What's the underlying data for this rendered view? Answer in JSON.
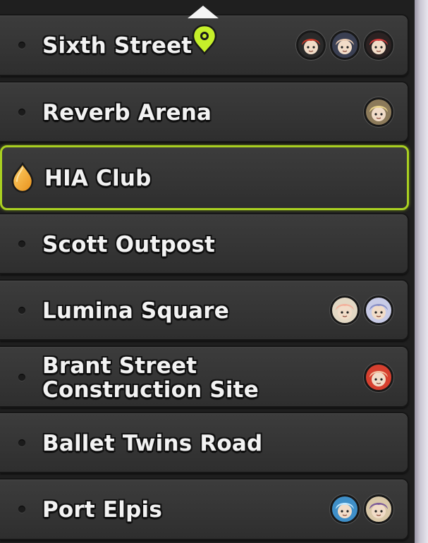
{
  "locations": [
    {
      "label": "Sixth Street",
      "avatars": [
        {
          "icon": "armored-agent-avatar-icon",
          "bg": "#2a2a2a",
          "accent": "#c83a2a"
        },
        {
          "icon": "dark-hair-agent-avatar-icon",
          "bg": "#3a3f52",
          "accent": "#e8c9b0"
        },
        {
          "icon": "red-black-agent-avatar-icon",
          "bg": "#2b2222",
          "accent": "#d23a3a"
        }
      ]
    },
    {
      "label": "Reverb Arena",
      "avatars": [
        {
          "icon": "blonde-agent-avatar-icon",
          "bg": "#8c7a5a",
          "accent": "#e9d38c"
        }
      ]
    },
    {
      "label": "HIA Club",
      "selected": true,
      "avatars": []
    },
    {
      "label": "Scott Outpost",
      "avatars": []
    },
    {
      "label": "Lumina Square",
      "avatars": [
        {
          "icon": "cream-hair-agent-avatar-icon",
          "bg": "#e3d8c4",
          "accent": "#f3b19c"
        },
        {
          "icon": "silver-hair-agent-avatar-icon",
          "bg": "#c8cbe6",
          "accent": "#8a90c6"
        }
      ]
    },
    {
      "label": "Brant Street\nConstruction Site",
      "avatars": [
        {
          "icon": "red-hair-agent-avatar-icon",
          "bg": "#d6402f",
          "accent": "#f2c0a0"
        }
      ]
    },
    {
      "label": "Ballet Twins Road",
      "avatars": []
    },
    {
      "label": "Port Elpis",
      "avatars": [
        {
          "icon": "blue-shark-agent-avatar-icon",
          "bg": "#3f8fc8",
          "accent": "#bfe7ff"
        },
        {
          "icon": "blonde-maid-agent-avatar-icon",
          "bg": "#d9c8a8",
          "accent": "#7c5a9a"
        }
      ]
    }
  ],
  "colors": {
    "selected_border": "#a9d021",
    "pin": "#c6f02a",
    "drop_light": "#ffd36b",
    "drop_dark": "#e8901a"
  }
}
